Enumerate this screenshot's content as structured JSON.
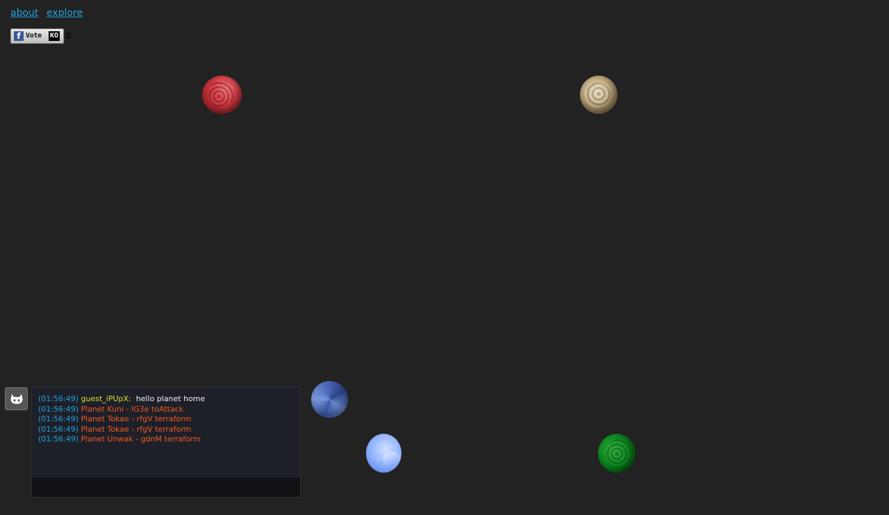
{
  "nav": {
    "about_label": "about",
    "explore_label": "explore"
  },
  "vote": {
    "fb_icon": "f",
    "label": "Vote",
    "badge": "KO",
    "count": "0"
  },
  "chat": {
    "messages": [
      {
        "time": "(01:56:49)",
        "user": "guest_iPUpX:",
        "text": "hello planet home",
        "kind": "user"
      },
      {
        "time": "(01:56:49)",
        "event": "Planet Kuni - lG3e toAttack",
        "kind": "event"
      },
      {
        "time": "(01:56:49)",
        "event": "Planet Tokae - rfgV terraform",
        "kind": "event"
      },
      {
        "time": "(01:56:49)",
        "event": "Planet Tokae - rfgV terraform",
        "kind": "event"
      },
      {
        "time": "(01:56:49)",
        "event": "Planet Unwak - gdnM terraform",
        "kind": "event"
      }
    ],
    "input_value": ""
  },
  "icons": {
    "github": "octocat-icon",
    "facebook": "facebook-icon"
  },
  "colors": {
    "background": "#222222",
    "link": "#1fa3e0",
    "chat_time": "#1fa3e0",
    "chat_user": "#d6e02a",
    "chat_event": "#f05a1f"
  }
}
